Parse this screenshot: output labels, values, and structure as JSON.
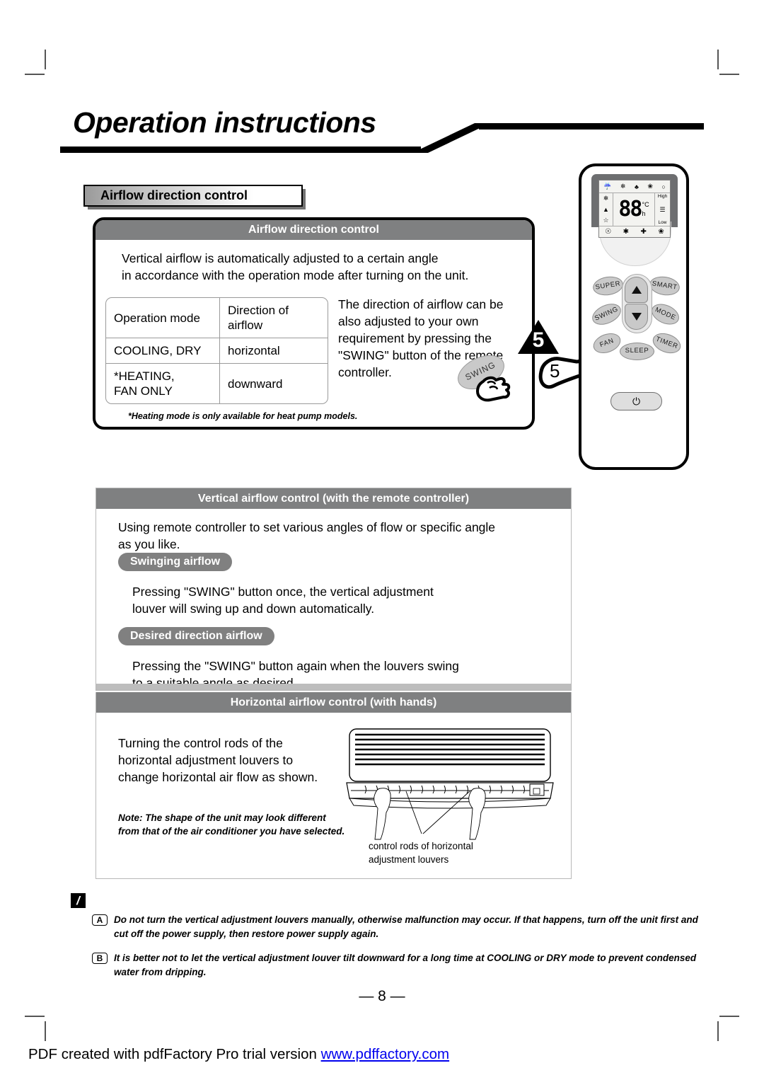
{
  "header": {
    "title": "Operation instructions"
  },
  "section_label": "Airflow direction control",
  "panel_airflow": {
    "heading": "Airflow direction control",
    "intro": "Vertical airflow is automatically adjusted to a certain angle\nin accordance with the operation mode after turning on the unit.",
    "table": {
      "headers": [
        "Operation mode",
        "Direction of airflow"
      ],
      "rows": [
        [
          "COOLING, DRY",
          "horizontal"
        ],
        [
          "*HEATING,\nFAN ONLY",
          "downward"
        ]
      ]
    },
    "swing_note": "The direction of airflow can be also adjusted to your own requirement by pressing the \"SWING\" button of the remote controller.",
    "footnote": "*Heating mode is only available for heat pump models.",
    "callout_number": "5",
    "hand_callout_number": "5",
    "swing_button_ghost_label": "SWING"
  },
  "remote": {
    "lcd": {
      "top_icons": [
        "signal-icon",
        "snowflake-icon",
        "drop-icon",
        "fan-icon",
        "circle-icon"
      ],
      "left_icons": [
        "snowflake-icon",
        "up-triangle-icon",
        "star-icon"
      ],
      "digits": "88",
      "unit_temp": "°C",
      "unit_hour": "h",
      "fan_high": "High",
      "fan_low": "Low",
      "bottom_icons": [
        "auto-icon",
        "snow-star-icon",
        "plus-fan-icon",
        "fan-blade-icon"
      ]
    },
    "buttons": [
      {
        "name": "super",
        "label": "SUPER"
      },
      {
        "name": "smart",
        "label": "SMART"
      },
      {
        "name": "swing",
        "label": "SWING"
      },
      {
        "name": "mode",
        "label": "MODE"
      },
      {
        "name": "fan",
        "label": "FAN"
      },
      {
        "name": "sleep",
        "label": "SLEEP"
      },
      {
        "name": "timer",
        "label": "TIMER"
      }
    ],
    "power_glyph": "⏻",
    "up_arrow": "up-arrow-icon",
    "down_arrow": "down-arrow-icon"
  },
  "panel_vertical": {
    "heading": "Vertical airflow control (with the remote controller)",
    "intro": "Using remote controller to set various angles of flow or specific angle\nas you like.",
    "pill_1": "Swinging airflow",
    "text_1": "Pressing \"SWING\" button once, the vertical adjustment\nlouver will swing up and down automatically.",
    "pill_2": "Desired direction airflow",
    "text_2": "Pressing the \"SWING\" button again when the louvers swing\nto a suitable angle as desired."
  },
  "panel_horizontal": {
    "heading": "Horizontal airflow control (with hands)",
    "text": "Turning the control rods of the\nhorizontal adjustment louvers to\nchange horizontal air flow as shown.",
    "note": "Note: The shape of the unit may look different\nfrom that of the air conditioner you have selected.",
    "caption": "control rods of horizontal\nadjustment louvers"
  },
  "caution": {
    "icon": "warning-exclamation-icon",
    "items": [
      {
        "badge": "A",
        "text": "Do not turn the vertical adjustment louvers manually, otherwise malfunction may occur. If that happens, turn off the unit first and cut off the power supply,  then restore power supply again."
      },
      {
        "badge": "B",
        "text": "It is better not to let the vertical adjustment louver tilt downward for a long time at COOLING or DRY mode to prevent condensed water from dripping."
      }
    ]
  },
  "footer": {
    "page_number": "— 8 —",
    "watermark_prefix": "PDF created with pdfFactory Pro trial version ",
    "watermark_link": "www.pdffactory.com"
  },
  "colors": {
    "band_gray": "#7f8081",
    "pill_gray": "#808080",
    "link_blue": "#0000ee"
  }
}
